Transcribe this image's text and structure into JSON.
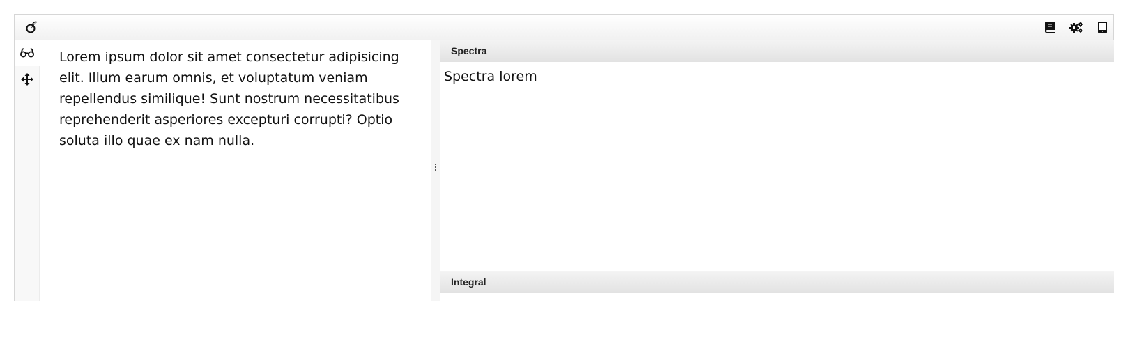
{
  "toolbar": {
    "logo_icon": "logo-icon",
    "docs_icon": "book-icon",
    "settings_icon": "gears-icon",
    "tablet_icon": "tablet-icon"
  },
  "side_tools": [
    {
      "icon": "glasses-icon"
    },
    {
      "icon": "move-arrows-icon"
    }
  ],
  "text_panel": {
    "content": "Lorem ipsum dolor sit amet consectetur adipisicing elit. Illum earum omnis, et voluptatum veniam repellendus similique! Sunt nostrum necessitatibus reprehenderit asperiores excepturi corrupti? Optio soluta illo quae ex nam nulla."
  },
  "panels": {
    "spectra": {
      "title": "Spectra",
      "content": "Spectra lorem"
    },
    "integral": {
      "title": "Integral"
    }
  },
  "colors": {
    "border": "#d6d6d6",
    "header_gradient_top": "#f4f4f4",
    "header_gradient_bottom": "#e2e2e2",
    "text": "#111111"
  }
}
